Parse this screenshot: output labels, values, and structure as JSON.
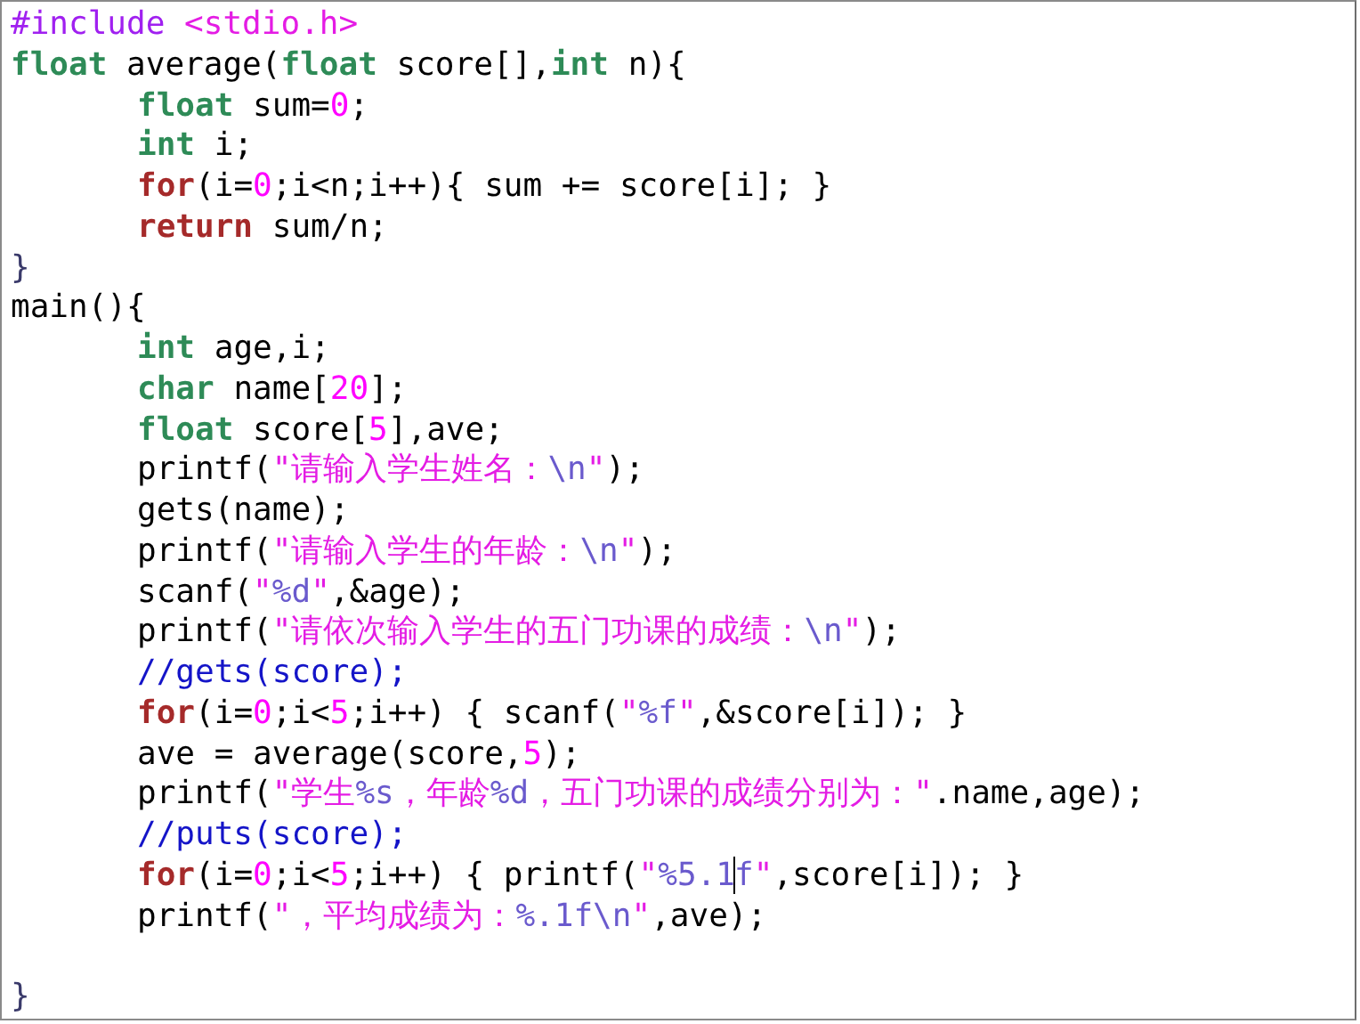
{
  "editor": {
    "lines": [
      {
        "kind": "code",
        "indented": false,
        "tokens": [
          {
            "kind": "pre",
            "text": "#include "
          },
          {
            "kind": "str",
            "text": "<stdio.h>"
          }
        ]
      },
      {
        "kind": "code",
        "indented": false,
        "tokens": [
          {
            "kind": "type",
            "text": "float"
          },
          {
            "kind": "plain",
            "text": " average("
          },
          {
            "kind": "type",
            "text": "float"
          },
          {
            "kind": "plain",
            "text": " score[],"
          },
          {
            "kind": "type",
            "text": "int"
          },
          {
            "kind": "plain",
            "text": " n){"
          }
        ]
      },
      {
        "kind": "code",
        "indented": true,
        "tokens": [
          {
            "kind": "type",
            "text": "float"
          },
          {
            "kind": "plain",
            "text": " sum="
          },
          {
            "kind": "num",
            "text": "0"
          },
          {
            "kind": "plain",
            "text": ";"
          }
        ]
      },
      {
        "kind": "code",
        "indented": true,
        "tokens": [
          {
            "kind": "type",
            "text": "int"
          },
          {
            "kind": "plain",
            "text": " i;"
          }
        ]
      },
      {
        "kind": "code",
        "indented": true,
        "tokens": [
          {
            "kind": "kw",
            "text": "for"
          },
          {
            "kind": "plain",
            "text": "(i="
          },
          {
            "kind": "num",
            "text": "0"
          },
          {
            "kind": "plain",
            "text": ";i<n;i++){ sum += score[i]; }"
          }
        ]
      },
      {
        "kind": "code",
        "indented": true,
        "tokens": [
          {
            "kind": "kw",
            "text": "return"
          },
          {
            "kind": "plain",
            "text": " sum/n;"
          }
        ]
      },
      {
        "kind": "code",
        "indented": false,
        "tokens": [
          {
            "kind": "brace",
            "text": "}"
          }
        ]
      },
      {
        "kind": "code",
        "indented": false,
        "tokens": [
          {
            "kind": "plain",
            "text": "main(){"
          }
        ]
      },
      {
        "kind": "code",
        "indented": true,
        "tokens": [
          {
            "kind": "type",
            "text": "int"
          },
          {
            "kind": "plain",
            "text": " age,i;"
          }
        ]
      },
      {
        "kind": "code",
        "indented": true,
        "tokens": [
          {
            "kind": "type",
            "text": "char"
          },
          {
            "kind": "plain",
            "text": " name["
          },
          {
            "kind": "num",
            "text": "20"
          },
          {
            "kind": "plain",
            "text": "];"
          }
        ]
      },
      {
        "kind": "code",
        "indented": true,
        "tokens": [
          {
            "kind": "type",
            "text": "float"
          },
          {
            "kind": "plain",
            "text": " score["
          },
          {
            "kind": "num",
            "text": "5"
          },
          {
            "kind": "plain",
            "text": "],ave;"
          }
        ]
      },
      {
        "kind": "code",
        "indented": true,
        "tokens": [
          {
            "kind": "plain",
            "text": "printf("
          },
          {
            "kind": "str",
            "text": "\"请输入学生姓名："
          },
          {
            "kind": "spec",
            "text": "\\n"
          },
          {
            "kind": "str",
            "text": "\""
          },
          {
            "kind": "plain",
            "text": ");"
          }
        ]
      },
      {
        "kind": "code",
        "indented": true,
        "tokens": [
          {
            "kind": "plain",
            "text": "gets(name);"
          }
        ]
      },
      {
        "kind": "code",
        "indented": true,
        "tokens": [
          {
            "kind": "plain",
            "text": "printf("
          },
          {
            "kind": "str",
            "text": "\"请输入学生的年龄："
          },
          {
            "kind": "spec",
            "text": "\\n"
          },
          {
            "kind": "str",
            "text": "\""
          },
          {
            "kind": "plain",
            "text": ");"
          }
        ]
      },
      {
        "kind": "code",
        "indented": true,
        "tokens": [
          {
            "kind": "plain",
            "text": "scanf("
          },
          {
            "kind": "str",
            "text": "\""
          },
          {
            "kind": "spec",
            "text": "%d"
          },
          {
            "kind": "str",
            "text": "\""
          },
          {
            "kind": "plain",
            "text": ",&age);"
          }
        ]
      },
      {
        "kind": "code",
        "indented": true,
        "tokens": [
          {
            "kind": "plain",
            "text": "printf("
          },
          {
            "kind": "str",
            "text": "\"请依次输入学生的五门功课的成绩："
          },
          {
            "kind": "spec",
            "text": "\\n"
          },
          {
            "kind": "str",
            "text": "\""
          },
          {
            "kind": "plain",
            "text": ");"
          }
        ]
      },
      {
        "kind": "code",
        "indented": true,
        "tokens": [
          {
            "kind": "com",
            "text": "//gets(score);"
          }
        ]
      },
      {
        "kind": "code",
        "indented": true,
        "tokens": [
          {
            "kind": "kw",
            "text": "for"
          },
          {
            "kind": "plain",
            "text": "(i="
          },
          {
            "kind": "num",
            "text": "0"
          },
          {
            "kind": "plain",
            "text": ";i<"
          },
          {
            "kind": "num",
            "text": "5"
          },
          {
            "kind": "plain",
            "text": ";i++) { scanf("
          },
          {
            "kind": "str",
            "text": "\""
          },
          {
            "kind": "spec",
            "text": "%f"
          },
          {
            "kind": "str",
            "text": "\""
          },
          {
            "kind": "plain",
            "text": ",&score[i]); }"
          }
        ]
      },
      {
        "kind": "code",
        "indented": true,
        "tokens": [
          {
            "kind": "plain",
            "text": "ave = average(score,"
          },
          {
            "kind": "num",
            "text": "5"
          },
          {
            "kind": "plain",
            "text": ");"
          }
        ]
      },
      {
        "kind": "code",
        "indented": true,
        "tokens": [
          {
            "kind": "plain",
            "text": "printf("
          },
          {
            "kind": "str",
            "text": "\"学生"
          },
          {
            "kind": "spec",
            "text": "%s"
          },
          {
            "kind": "str",
            "text": "，年龄"
          },
          {
            "kind": "spec",
            "text": "%d"
          },
          {
            "kind": "str",
            "text": "，五门功课的成绩分别为：\""
          },
          {
            "kind": "plain",
            "text": ".name,age);"
          }
        ]
      },
      {
        "kind": "code",
        "indented": true,
        "tokens": [
          {
            "kind": "com",
            "text": "//puts(score);"
          }
        ]
      },
      {
        "kind": "code",
        "indented": true,
        "tokens": [
          {
            "kind": "kw",
            "text": "for"
          },
          {
            "kind": "plain",
            "text": "(i="
          },
          {
            "kind": "num",
            "text": "0"
          },
          {
            "kind": "plain",
            "text": ";i<"
          },
          {
            "kind": "num",
            "text": "5"
          },
          {
            "kind": "plain",
            "text": ";i++) { printf("
          },
          {
            "kind": "str",
            "text": "\""
          },
          {
            "kind": "spec",
            "text": "%5.1"
          },
          {
            "kind": "cursor_spec",
            "text": "f"
          },
          {
            "kind": "str",
            "text": "\""
          },
          {
            "kind": "plain",
            "text": ",score[i]); }"
          }
        ]
      },
      {
        "kind": "code",
        "indented": true,
        "tokens": [
          {
            "kind": "plain",
            "text": "printf("
          },
          {
            "kind": "str",
            "text": "\"，平均成绩为："
          },
          {
            "kind": "spec",
            "text": "%.1f\\n"
          },
          {
            "kind": "str",
            "text": "\""
          },
          {
            "kind": "plain",
            "text": ",ave);"
          }
        ]
      },
      {
        "kind": "blank"
      },
      {
        "kind": "code",
        "indented": false,
        "tokens": [
          {
            "kind": "brace",
            "text": "}"
          }
        ]
      }
    ]
  }
}
